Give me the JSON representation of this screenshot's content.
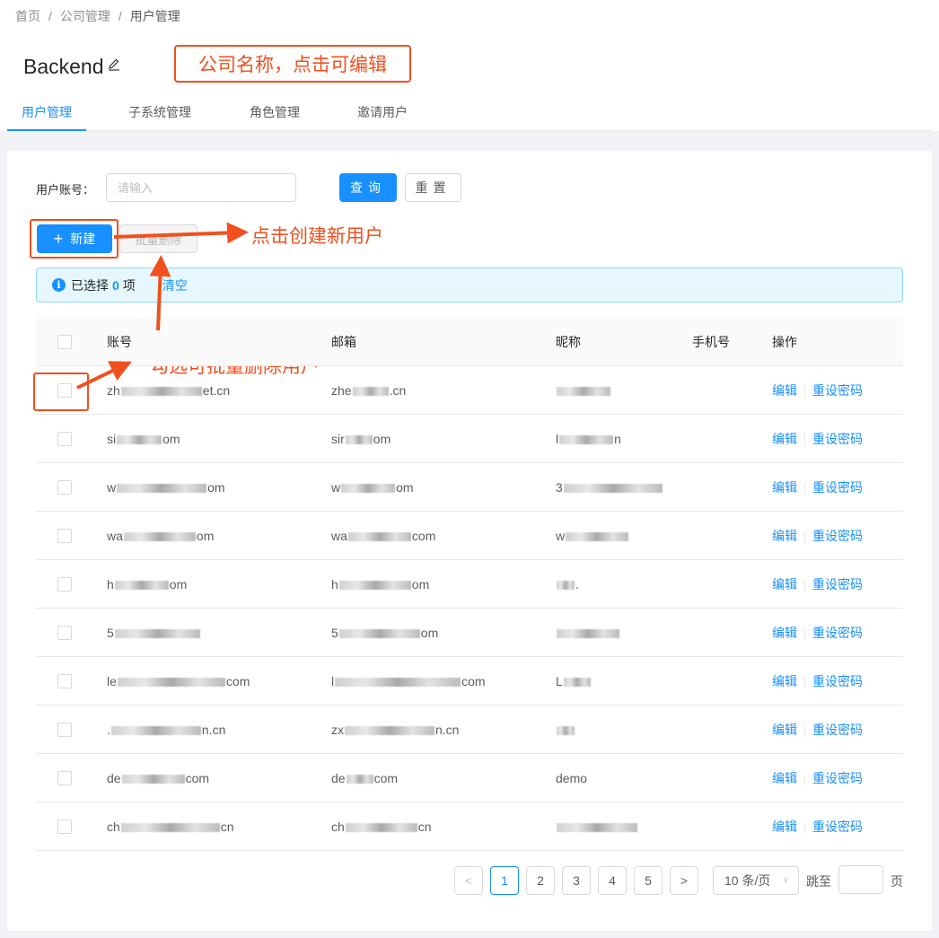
{
  "breadcrumb": [
    "首页",
    "公司管理",
    "用户管理"
  ],
  "company": {
    "name": "Backend"
  },
  "annotations": {
    "company_name": "公司名称，点击可编辑",
    "new_user": "点击创建新用户",
    "batch_delete": "勾选可批量删除用户"
  },
  "tabs": [
    "用户管理",
    "子系统管理",
    "角色管理",
    "邀请用户"
  ],
  "filter": {
    "label": "用户账号：",
    "placeholder": "请输入",
    "search": "查询",
    "reset": "重置"
  },
  "actions": {
    "new": "新建",
    "batch_delete": "批量删除"
  },
  "selection": {
    "prefix": "已选择",
    "count": "0",
    "suffix": "项",
    "clear": "清空"
  },
  "table": {
    "columns": [
      "账号",
      "邮箱",
      "昵称",
      "手机号",
      "操作"
    ],
    "rows": [
      {
        "account": [
          "zh",
          "et.cn"
        ],
        "email": [
          "zhe",
          ".cn"
        ],
        "nickname": [
          "",
          ""
        ]
      },
      {
        "account": [
          "si",
          "om"
        ],
        "email": [
          "sir",
          "om"
        ],
        "nickname": [
          "l",
          "n"
        ]
      },
      {
        "account": [
          "w",
          "om"
        ],
        "email": [
          "w",
          "om"
        ],
        "nickname": [
          "3",
          ""
        ]
      },
      {
        "account": [
          "wa",
          "om"
        ],
        "email": [
          "wa",
          "com"
        ],
        "nickname": [
          "w",
          ""
        ]
      },
      {
        "account": [
          "h",
          "om"
        ],
        "email": [
          "h",
          "om"
        ],
        "nickname": [
          "",
          "."
        ]
      },
      {
        "account": [
          "5",
          ""
        ],
        "email": [
          "5",
          "om"
        ],
        "nickname": [
          "",
          ""
        ]
      },
      {
        "account": [
          "le",
          "com"
        ],
        "email": [
          "l",
          "com"
        ],
        "nickname": [
          "L",
          ""
        ]
      },
      {
        "account": [
          ".",
          "n.cn"
        ],
        "email": [
          "zx",
          "n.cn"
        ],
        "nickname": [
          "",
          ""
        ]
      },
      {
        "account": [
          "de",
          "com"
        ],
        "email": [
          "de",
          "com"
        ],
        "nickname": [
          "demo",
          ""
        ]
      },
      {
        "account": [
          "ch",
          "cn"
        ],
        "email": [
          "ch",
          "cn"
        ],
        "nickname": [
          "",
          ""
        ]
      }
    ],
    "edit": "编辑",
    "reset_password": "重设密码"
  },
  "pagination": {
    "prev": "<",
    "next": ">",
    "pages": [
      "1",
      "2",
      "3",
      "4",
      "5"
    ],
    "current": "1",
    "page_size": "10 条/页",
    "jump_prefix": "跳至",
    "jump_suffix": "页"
  },
  "colors": {
    "primary": "#1890ff",
    "annotation": "#f0501e"
  }
}
